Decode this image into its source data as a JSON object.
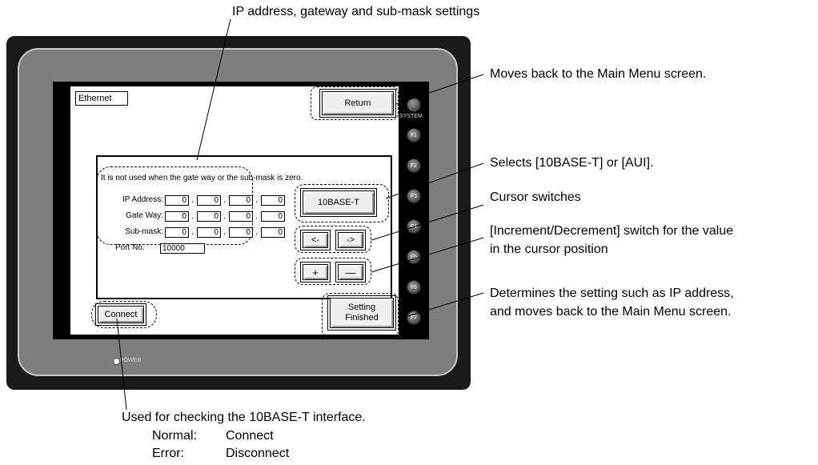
{
  "callouts": {
    "ip_settings": "IP address, gateway and sub-mask settings",
    "return": "Moves back to the Main Menu screen.",
    "select_10baset": "Selects [10BASE-T] or [AUI].",
    "cursor": "Cursor switches",
    "incdec_line1": "[Increment/Decrement] switch for the value",
    "incdec_line2": "in the cursor position",
    "setting_line1": "Determines the setting such as IP address,",
    "setting_line2": "and moves back to the Main Menu screen.",
    "connect_line1": "Used for checking the 10BASE-T interface.",
    "normal_label": "Normal:",
    "normal_value": "Connect",
    "error_label": "Error:",
    "error_value": "Disconnect"
  },
  "screen": {
    "title": "Ethernet",
    "return_button": "Return",
    "note": "It is not used when the gate way or the sub-mask is zero.",
    "ip_label": "IP Address:",
    "gateway_label": "Gate Way:",
    "submask_label": "Sub-mask:",
    "ip_values": [
      "0",
      "0",
      "0",
      "0"
    ],
    "gateway_values": [
      "0",
      "0",
      "0",
      "0"
    ],
    "submask_values": [
      "0",
      "0",
      "0",
      "0"
    ],
    "dot": ".",
    "port_label": "Port No.",
    "port_value": "10000",
    "interface_button": "10BASE-T",
    "cursor_left": "<-",
    "cursor_right": "->",
    "plus": "+",
    "minus": "—",
    "connect_button": "Connect",
    "setting_line1": "Setting",
    "setting_line2": "Finished"
  },
  "panel": {
    "system_label": "SYSTEM",
    "fkeys": [
      "F1",
      "F2",
      "F3",
      "F4",
      "F5",
      "F6",
      "F7"
    ],
    "power_label": "POWER"
  },
  "colors": {
    "bezel": "#1a1a1a",
    "bezel_inner": "#7e7e7e",
    "screen": "#ffffff"
  }
}
